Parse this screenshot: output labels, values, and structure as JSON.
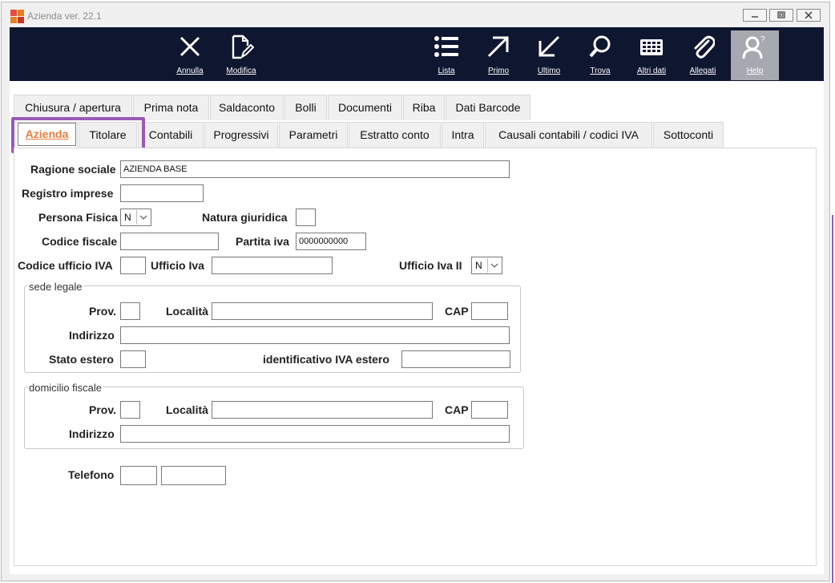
{
  "window": {
    "title": "Azienda ver. 22.1"
  },
  "toolbar": {
    "annulla": "Annulla",
    "modifica": "Modifica",
    "lista": "Lista",
    "primo": "Primo",
    "ultimo": "Ultimo",
    "trova": "Trova",
    "altri_dati": "Altri dati",
    "allegati": "Allegati",
    "help": "Help"
  },
  "tabs_row1": [
    "Chiusura / apertura",
    "Prima nota",
    "Saldaconto",
    "Bolli",
    "Documenti",
    "Riba",
    "Dati Barcode"
  ],
  "tabs_row2": [
    "Azienda",
    "Titolare",
    "Contabili",
    "Progressivi",
    "Parametri",
    "Estratto conto",
    "Intra",
    "Causali contabili / codici IVA",
    "Sottoconti"
  ],
  "form": {
    "ragione_sociale": {
      "label": "Ragione sociale",
      "value": "AZIENDA BASE"
    },
    "registro_imprese": {
      "label": "Registro imprese",
      "value": ""
    },
    "persona_fisica": {
      "label": "Persona Fisica",
      "value": "N"
    },
    "natura_giuridica": {
      "label": "Natura giuridica",
      "value": ""
    },
    "codice_fiscale": {
      "label": "Codice fiscale",
      "value": ""
    },
    "partita_iva": {
      "label": "Partita iva",
      "value": "0000000000"
    },
    "codice_ufficio_iva": {
      "label": "Codice ufficio IVA",
      "value": ""
    },
    "ufficio_iva": {
      "label": "Ufficio Iva",
      "value": ""
    },
    "ufficio_iva_ii": {
      "label": "Ufficio Iva II",
      "value": "N"
    },
    "sede_legale": {
      "legend": "sede legale",
      "prov_label": "Prov.",
      "prov": "",
      "localita_label": "Località",
      "localita": "",
      "cap_label": "CAP",
      "cap": "",
      "indirizzo_label": "Indirizzo",
      "indirizzo": "",
      "stato_estero_label": "Stato estero",
      "stato_estero": "",
      "id_iva_estero_label": "identificativo IVA estero",
      "id_iva_estero": ""
    },
    "domicilio_fiscale": {
      "legend": "domicilio fiscale",
      "prov_label": "Prov.",
      "prov": "",
      "localita_label": "Località",
      "localita": "",
      "cap_label": "CAP",
      "cap": "",
      "indirizzo_label": "Indirizzo",
      "indirizzo": ""
    },
    "telefono": {
      "label": "Telefono",
      "prefisso": "",
      "numero": ""
    }
  },
  "colors": {
    "toolbar_bg": "#0e1630",
    "active_tab": "#e67e3d",
    "highlight": "#9b59b6"
  }
}
